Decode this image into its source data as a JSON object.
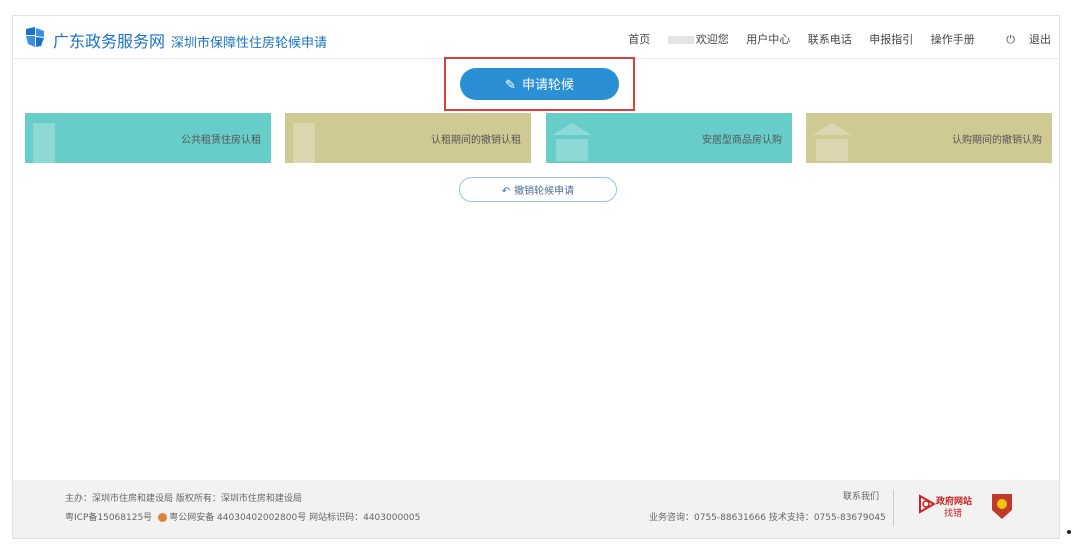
{
  "header": {
    "brand_title": "广东政务服务网",
    "brand_subtitle": "深圳市保障性住房轮候申请",
    "nav": {
      "home": "首页",
      "welcome": "欢迎您",
      "user_center": "用户中心",
      "contact_phone": "联系电话",
      "guide": "申报指引",
      "manual": "操作手册",
      "logout": "退出"
    }
  },
  "main": {
    "apply_button": "申请轮候",
    "cards": [
      {
        "label": "公共租赁住房认租"
      },
      {
        "label": "认租期间的撤销认租"
      },
      {
        "label": "安居型商品房认购"
      },
      {
        "label": "认购期间的撤销认购"
      }
    ],
    "revoke_button": "撤销轮候申请"
  },
  "footer": {
    "line1": "主办：深圳市住房和建设局 版权所有：深圳市住房和建设局",
    "icp": "粤ICP备15068125号",
    "police": "粤公网安备 44030402002800号",
    "site_code": "网站标识码：4403000005",
    "contact_us": "联系我们",
    "hotline": "业务咨询：0755-88631666 技术支持：0755-83679045",
    "gov_logo_line1": "政府网站",
    "gov_logo_line2": "找错"
  },
  "colors": {
    "brand_blue": "#1a73c8",
    "button_blue": "#2b8fd6",
    "highlight_red": "#e03d3d",
    "card_teal": "#66cdc9",
    "card_khaki": "#cfc994"
  }
}
